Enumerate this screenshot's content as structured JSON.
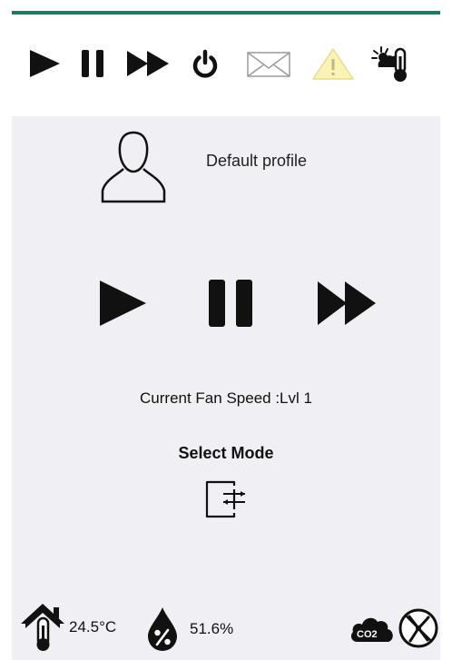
{
  "toolbar": {
    "items": [
      {
        "name": "play-icon"
      },
      {
        "name": "pause-icon"
      },
      {
        "name": "fast-forward-icon"
      },
      {
        "name": "power-icon"
      },
      {
        "name": "mail-icon"
      },
      {
        "name": "warning-icon"
      },
      {
        "name": "weather-thermometer-icon"
      }
    ]
  },
  "profile": {
    "name": "Default profile"
  },
  "controls": {
    "fan_speed_label": "Current Fan Speed :",
    "fan_speed_value": "Lvl 1",
    "select_mode_label": "Select Mode"
  },
  "status": {
    "indoor_temperature": "24.5°C",
    "humidity": "51.6%",
    "co2_label": "CO2"
  },
  "colors": {
    "accent_line": "#1e7a5a",
    "panel_bg": "#efeff4",
    "warning_fill": "#fbf3b6",
    "icon_dark": "#111111"
  }
}
